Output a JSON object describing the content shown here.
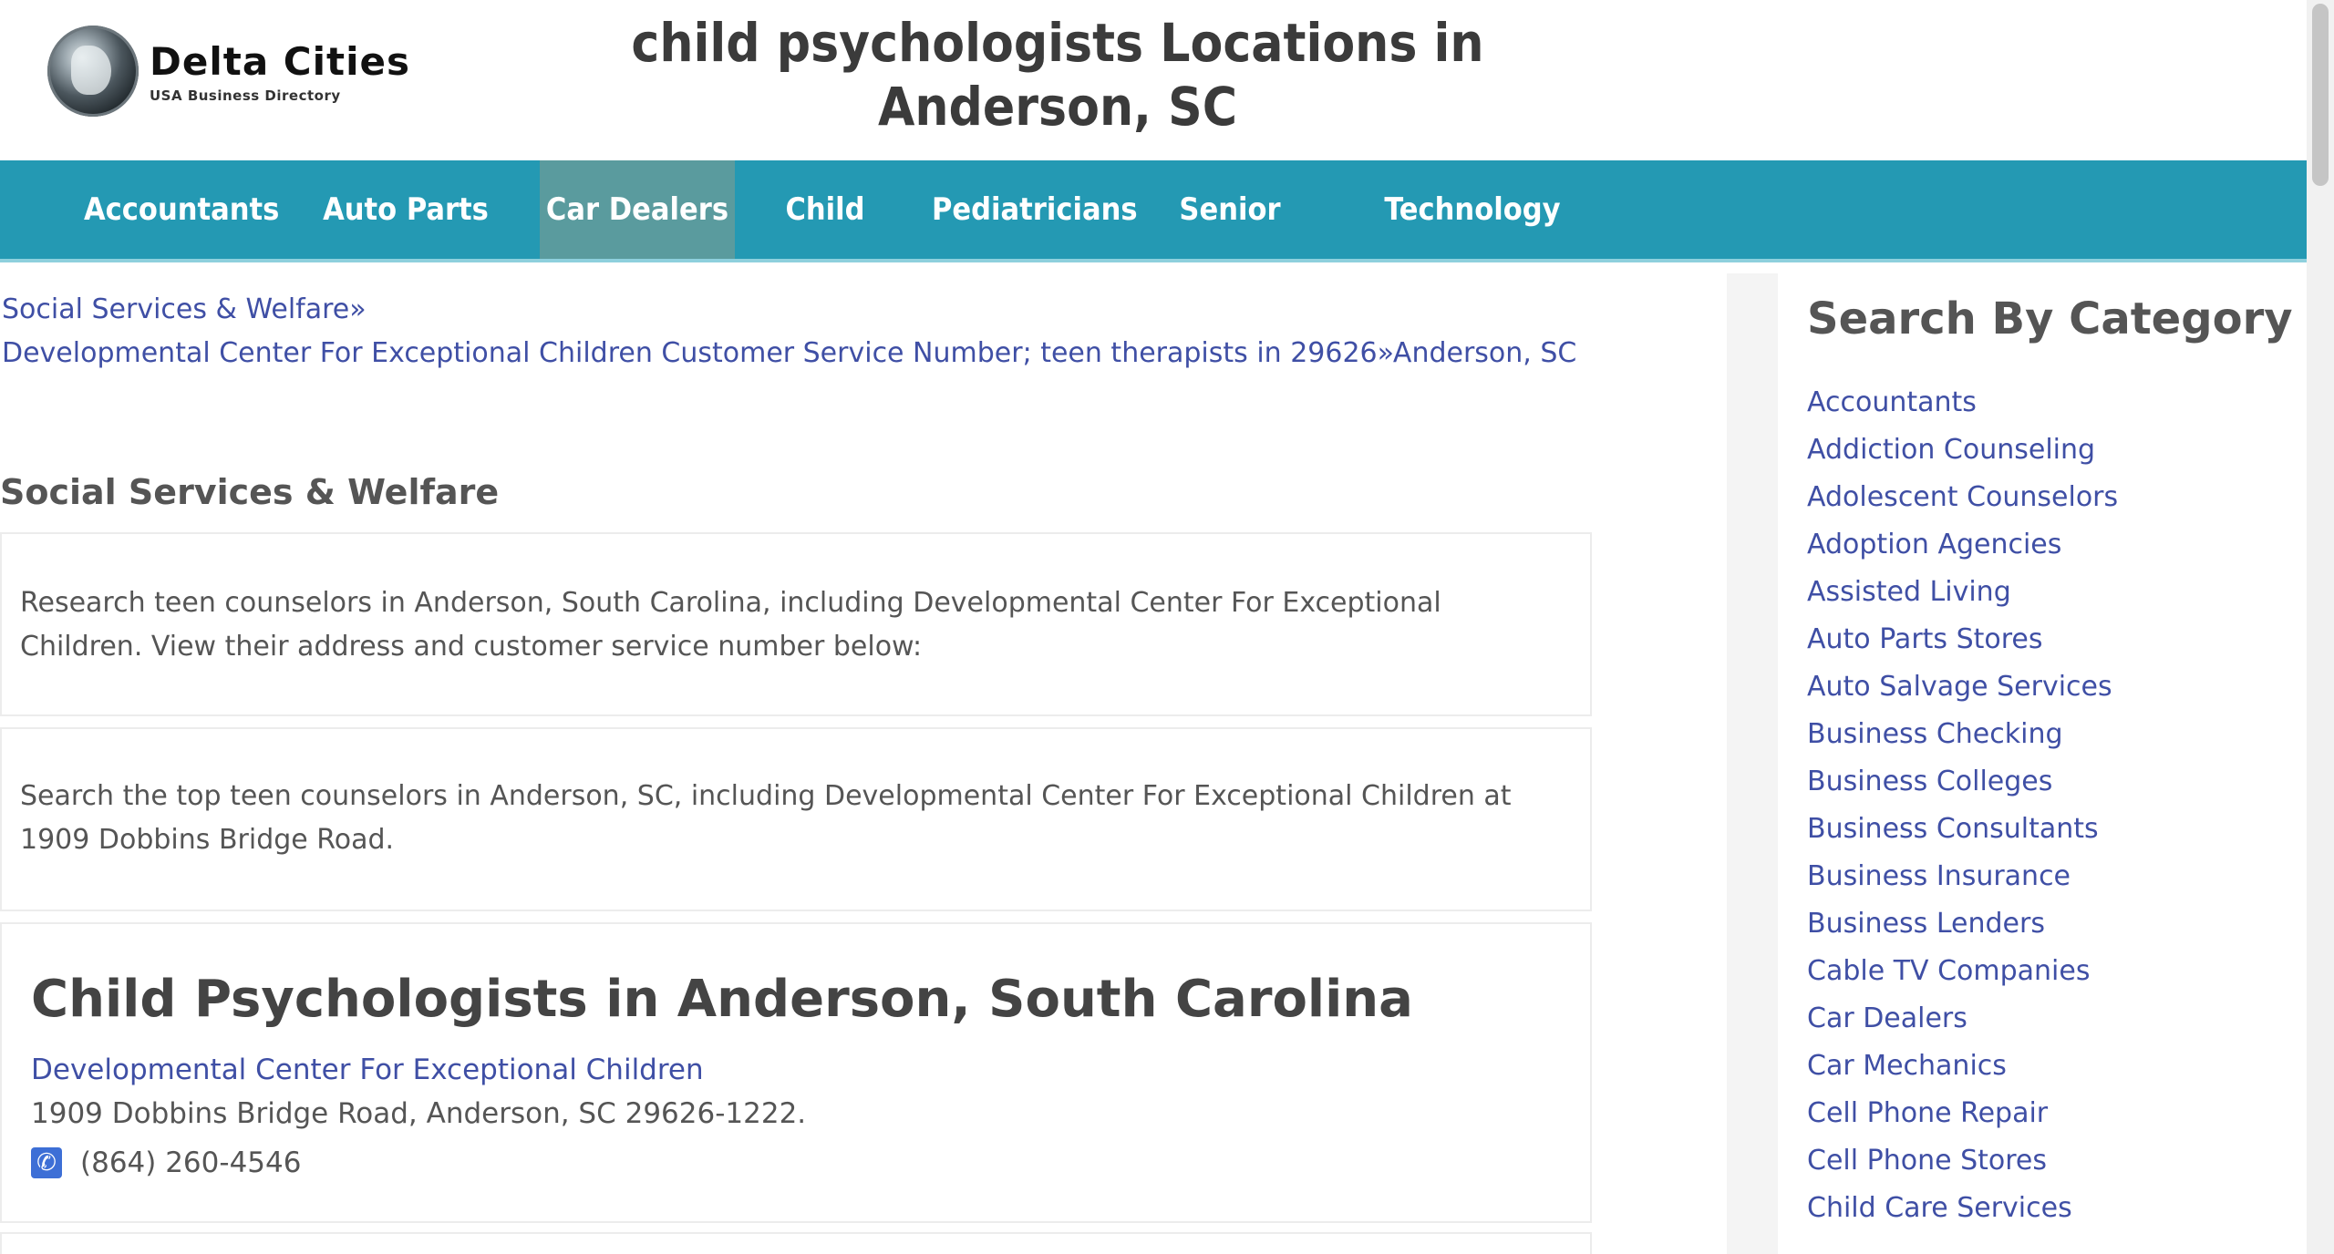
{
  "header": {
    "logo_title": "Delta Cities",
    "logo_subtitle": "USA Business Directory",
    "page_title": "child psychologists Locations in Anderson, SC"
  },
  "nav": {
    "items": [
      {
        "label": "Accountants",
        "active": false
      },
      {
        "label": "Auto Parts Stores",
        "active": false
      },
      {
        "label": "Car Dealers",
        "active": true
      },
      {
        "label": "Child Care",
        "active": false
      },
      {
        "label": "Pediatricians",
        "active": false
      },
      {
        "label": "Senior Care",
        "active": false
      },
      {
        "label": "Technology Schools",
        "active": false
      }
    ]
  },
  "breadcrumb": {
    "first": "Social Services & Welfare»",
    "second": "Developmental Center For Exceptional Children Customer Service Number; teen therapists in 29626»Anderson, SC"
  },
  "main": {
    "section_heading": "Social Services & Welfare",
    "intro_text": "Research teen counselors in Anderson, South Carolina, including Developmental Center For Exceptional Children. View their address and customer service number below:",
    "search_text": "Search the top teen counselors in Anderson, SC, including Developmental Center For Exceptional Children at 1909 Dobbins Bridge Road.",
    "listing": {
      "heading": "Child Psychologists in Anderson, South Carolina",
      "name": "Developmental Center For Exceptional Children",
      "address": "1909 Dobbins Bridge Road, Anderson, SC 29626-1222.",
      "phone": "(864) 260-4546",
      "phone_icon": "phone-icon"
    }
  },
  "sidebar": {
    "heading": "Search By Category",
    "categories": [
      "Accountants",
      "Addiction Counseling",
      "Adolescent Counselors",
      "Adoption Agencies",
      "Assisted Living",
      "Auto Parts Stores",
      "Auto Salvage Services",
      "Business Checking",
      "Business Colleges",
      "Business Consultants",
      "Business Insurance",
      "Business Lenders",
      "Cable TV Companies",
      "Car Dealers",
      "Car Mechanics",
      "Cell Phone Repair",
      "Cell Phone Stores",
      "Child Care Services"
    ]
  },
  "colors": {
    "nav_bg": "#2499b3",
    "nav_active": "#5a9b9e",
    "link": "#3f4fa5"
  }
}
